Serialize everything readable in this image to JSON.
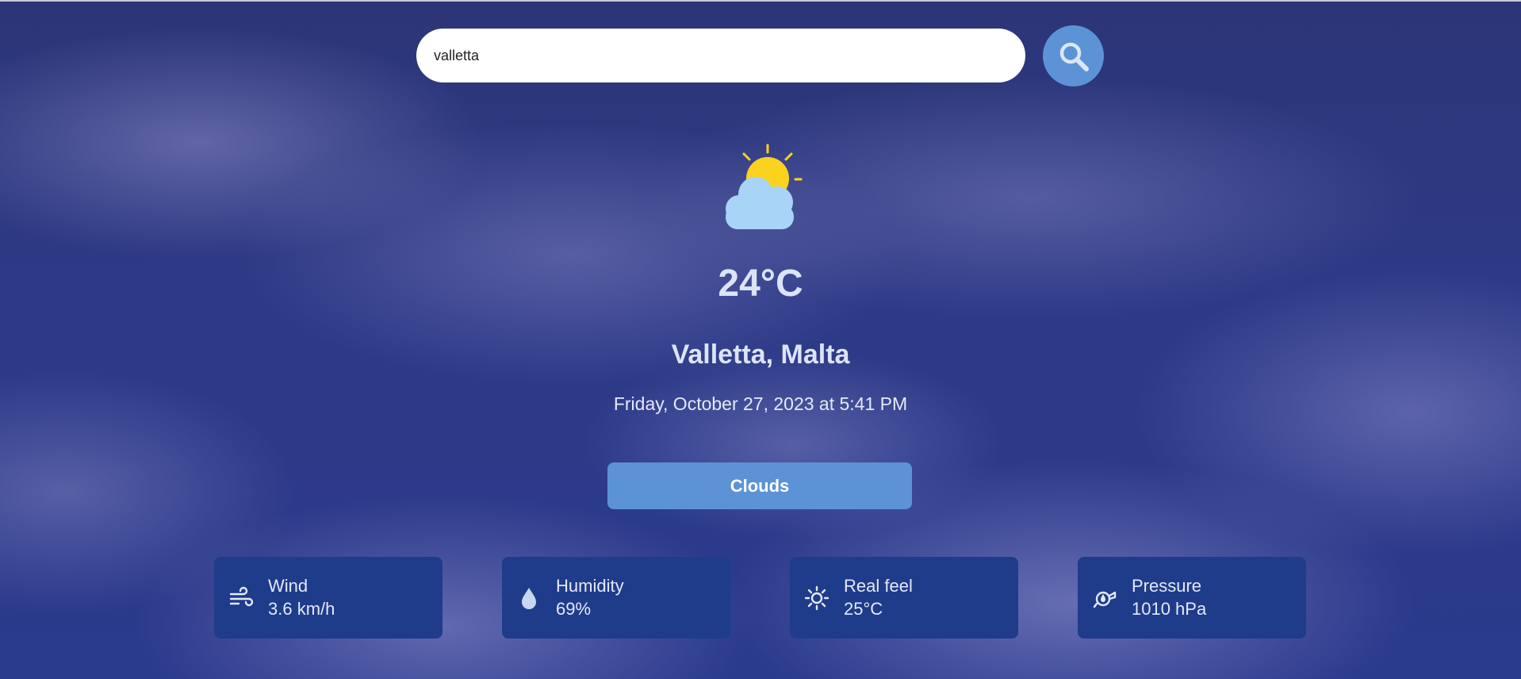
{
  "search": {
    "value": "valletta",
    "button_icon": "search-icon"
  },
  "weather": {
    "icon": "partly-cloudy-icon",
    "temperature": "24°C",
    "location": "Valletta, Malta",
    "datetime": "Friday, October 27, 2023 at 5:41 PM",
    "condition": "Clouds"
  },
  "stats": [
    {
      "icon": "wind-icon",
      "label": "Wind",
      "value": "3.6 km/h"
    },
    {
      "icon": "droplet-icon",
      "label": "Humidity",
      "value": "69%"
    },
    {
      "icon": "sun-icon",
      "label": "Real feel",
      "value": "25°C"
    },
    {
      "icon": "pressure-gauge-icon",
      "label": "Pressure",
      "value": "1010 hPa"
    }
  ],
  "colors": {
    "accent": "#5b93d6",
    "card": "#1f3c8a",
    "text": "#dbe4f7",
    "sun": "#fcd21f",
    "cloud": "#a8d4f7"
  }
}
